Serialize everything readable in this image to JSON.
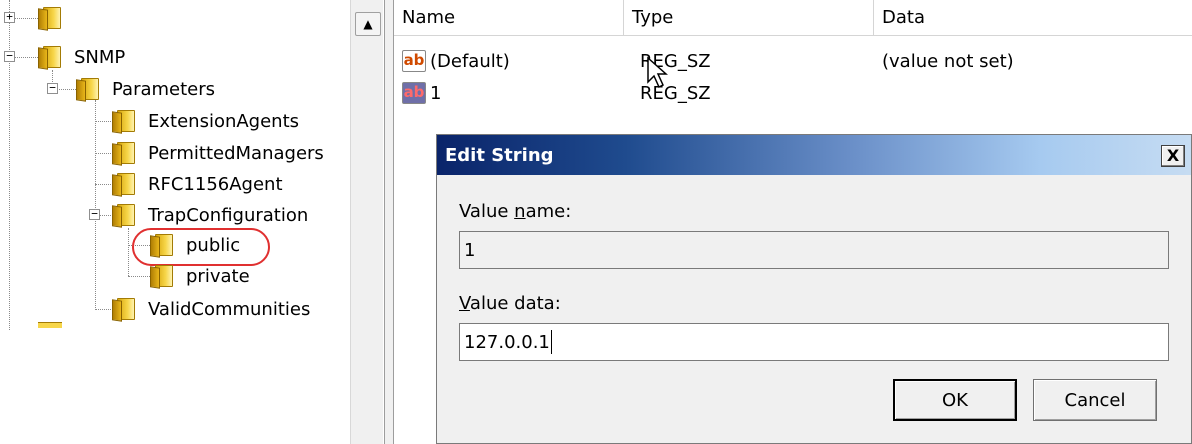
{
  "tree": {
    "nodes": [
      {
        "label": "SNMP"
      },
      {
        "label": "Parameters"
      },
      {
        "label": "ExtensionAgents"
      },
      {
        "label": "PermittedManagers"
      },
      {
        "label": "RFC1156Agent"
      },
      {
        "label": "TrapConfiguration"
      },
      {
        "label": "public"
      },
      {
        "label": "private"
      },
      {
        "label": "ValidCommunities"
      }
    ],
    "expand_plus": "+",
    "expand_minus": "−"
  },
  "scrollbar": {
    "up_arrow": "▲"
  },
  "list": {
    "columns": [
      "Name",
      "Type",
      "Data"
    ],
    "rows": [
      {
        "name": "(Default)",
        "type": "REG_SZ",
        "data": "(value not set)",
        "icon": "ab-string-icon"
      },
      {
        "name": "1",
        "type": "REG_SZ",
        "data": "",
        "icon": "ab-string-icon"
      }
    ],
    "icon_text": "ab"
  },
  "dialog": {
    "title": "Edit String",
    "close_label": "X",
    "value_name_label_pre": "Value ",
    "value_name_label_u": "n",
    "value_name_label_post": "ame:",
    "value_name": "1",
    "value_data_label_u": "V",
    "value_data_label_post": "alue data:",
    "value_data": "127.0.0.1",
    "ok_label": "OK",
    "cancel_label": "Cancel"
  }
}
